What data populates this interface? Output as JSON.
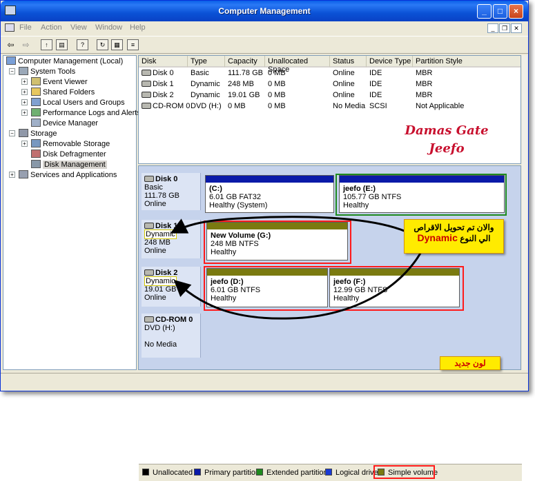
{
  "window": {
    "title": "Computer Management"
  },
  "menu": [
    "File",
    "Action",
    "View",
    "Window",
    "Help"
  ],
  "tree": [
    {
      "label": "Computer Management (Local)",
      "icon": "computer-icon",
      "color": "#7aa0d8"
    },
    {
      "label": "System Tools",
      "icon": "tools-icon",
      "color": "#9aa8b8"
    },
    {
      "label": "Event Viewer",
      "icon": "event-viewer-icon",
      "color": "#d0c070"
    },
    {
      "label": "Shared Folders",
      "icon": "folder-icon",
      "color": "#e8c860"
    },
    {
      "label": "Local Users and Groups",
      "icon": "users-icon",
      "color": "#80a0d0"
    },
    {
      "label": "Performance Logs and Alerts",
      "icon": "perf-logs-icon",
      "color": "#70b070"
    },
    {
      "label": "Device Manager",
      "icon": "device-manager-icon",
      "color": "#a0b0c8"
    },
    {
      "label": "Storage",
      "icon": "storage-icon",
      "color": "#9098a8"
    },
    {
      "label": "Removable Storage",
      "icon": "removable-storage-icon",
      "color": "#7898c0"
    },
    {
      "label": "Disk Defragmenter",
      "icon": "defrag-icon",
      "color": "#c07070"
    },
    {
      "label": "Disk Management",
      "icon": "disk-management-icon",
      "color": "#8898a8"
    },
    {
      "label": "Services and Applications",
      "icon": "services-icon",
      "color": "#98a0b0"
    }
  ],
  "disklist": {
    "columns": [
      "Disk",
      "Type",
      "Capacity",
      "Unallocated Space",
      "Status",
      "Device Type",
      "Partition Style"
    ],
    "rows": [
      [
        "Disk 0",
        "Basic",
        "111.78 GB",
        "0 MB",
        "Online",
        "IDE",
        "MBR"
      ],
      [
        "Disk 1",
        "Dynamic",
        "248 MB",
        "0 MB",
        "Online",
        "IDE",
        "MBR"
      ],
      [
        "Disk 2",
        "Dynamic",
        "19.01 GB",
        "0 MB",
        "Online",
        "IDE",
        "MBR"
      ],
      [
        "CD-ROM 0",
        "DVD (H:)",
        "0 MB",
        "0 MB",
        "No Media",
        "SCSI",
        "Not Applicable"
      ]
    ]
  },
  "graph": {
    "disks": [
      {
        "name": "Disk 0",
        "type": "Basic",
        "size": "111.78 GB",
        "status": "Online"
      },
      {
        "name": "Disk 1",
        "type": "Dynamic",
        "size": "248 MB",
        "status": "Online"
      },
      {
        "name": "Disk 2",
        "type": "Dynamic",
        "size": "19.01 GB",
        "status": "Online"
      },
      {
        "name": "CD-ROM 0",
        "type": "DVD (H:)",
        "size": "",
        "status": "No Media"
      }
    ],
    "volumes": {
      "c": {
        "name": "(C:)",
        "size": "6.01 GB FAT32",
        "status": "Healthy (System)"
      },
      "e": {
        "name": "jeefo  (E:)",
        "size": "105.77 GB NTFS",
        "status": "Healthy"
      },
      "g": {
        "name": "New Volume  (G:)",
        "size": "248 MB NTFS",
        "status": "Healthy"
      },
      "d": {
        "name": "jeefo  (D:)",
        "size": "6.01 GB NTFS",
        "status": "Healthy"
      },
      "f": {
        "name": "jeefo  (F:)",
        "size": "12.99 GB NTFS",
        "status": "Healthy"
      }
    }
  },
  "legend": [
    {
      "label": "Unallocated",
      "color": "#000000"
    },
    {
      "label": "Primary partition",
      "color": "#0a1aa8"
    },
    {
      "label": "Extended partition",
      "color": "#1e8a1e"
    },
    {
      "label": "Logical drive",
      "color": "#1a3ad6"
    },
    {
      "label": "Simple volume",
      "color": "#7a7a10"
    }
  ],
  "colors": {
    "primary_bar": "#0a1aa8",
    "simple_bar": "#7a7a10",
    "extended_border": "#1e8a1e",
    "highlight_red": "#ff1a1a",
    "callout_yellow": "#ffeb00"
  },
  "annotations": {
    "watermark_line1": "Damas Gate",
    "watermark_line2": "Jeefo",
    "arabic_line1": "والان تم تحويل الاقراص",
    "arabic_line2": "الي النوع",
    "arabic_dynamic": "Dynamic",
    "new_color": "لون جديد"
  }
}
